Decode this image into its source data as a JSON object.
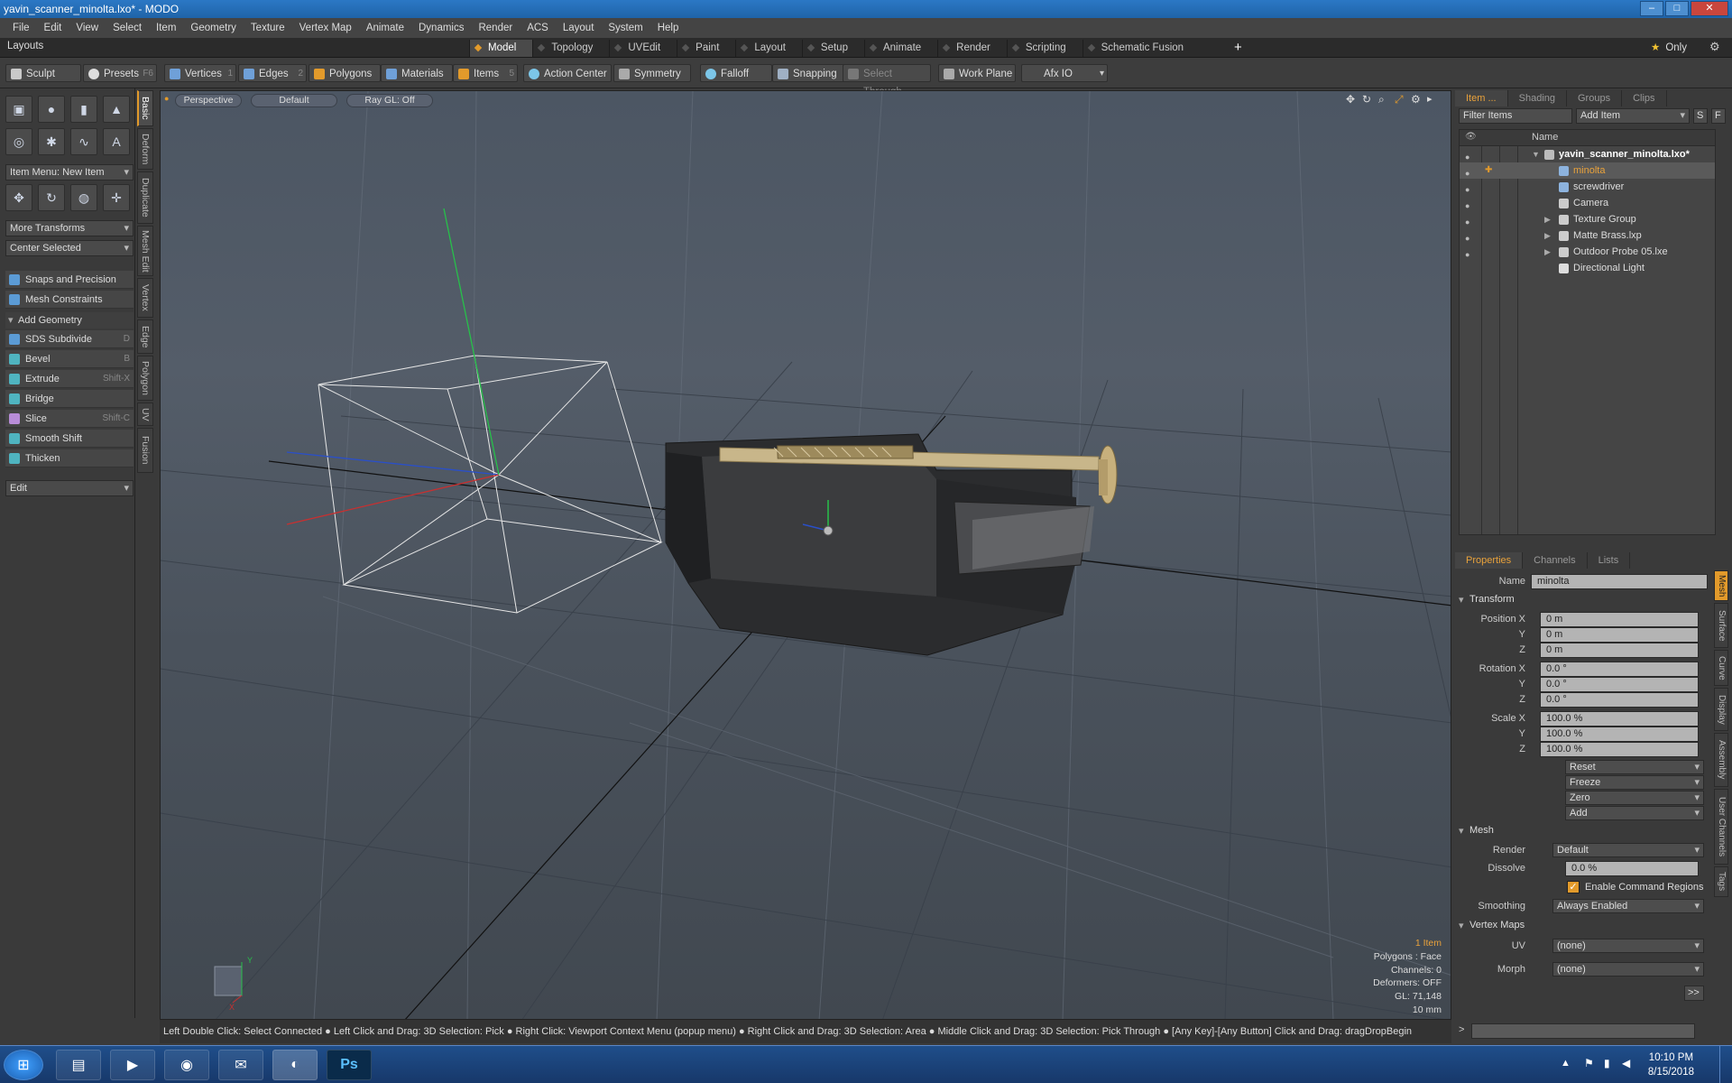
{
  "window": {
    "title": "yavin_scanner_minolta.lxo* - MODO",
    "min": "–",
    "max": "□",
    "close": "✕"
  },
  "menu": [
    "File",
    "Edit",
    "View",
    "Select",
    "Item",
    "Geometry",
    "Texture",
    "Vertex Map",
    "Animate",
    "Dynamics",
    "Render",
    "ACS",
    "Layout",
    "System",
    "Help"
  ],
  "layout_bar": {
    "label": "Layouts",
    "tabs": [
      "Model",
      "Topology",
      "UVEdit",
      "Paint",
      "Layout",
      "Setup",
      "Animate",
      "Render",
      "Scripting",
      "Schematic Fusion"
    ],
    "active": "Model",
    "plus": "+",
    "only": "Only",
    "star": "★"
  },
  "toolbar": {
    "sculpt": "Sculpt",
    "presets": "Presets",
    "presets_key": "F6",
    "vertices": "Vertices",
    "vertices_n": "1",
    "edges": "Edges",
    "edges_n": "2",
    "polygons": "Polygons",
    "materials": "Materials",
    "items": "Items",
    "items_n": "5",
    "action_center": "Action Center",
    "symmetry": "Symmetry",
    "falloff": "Falloff",
    "snapping": "Snapping",
    "select_through": "Select Through",
    "work_plane": "Work Plane",
    "afx": "Afx IO"
  },
  "left_panel": {
    "item_menu": "Item Menu: New Item",
    "more_transforms": "More Transforms",
    "center_selected": "Center Selected",
    "snaps": "Snaps and Precision",
    "mesh_constraints": "Mesh Constraints",
    "add_geometry": "Add Geometry",
    "tools": [
      {
        "label": "SDS Subdivide",
        "key": "D"
      },
      {
        "label": "Bevel",
        "key": "B"
      },
      {
        "label": "Extrude",
        "key": "Shift-X"
      },
      {
        "label": "Bridge",
        "key": ""
      },
      {
        "label": "Slice",
        "key": "Shift-C"
      },
      {
        "label": "Smooth Shift",
        "key": ""
      },
      {
        "label": "Thicken",
        "key": ""
      }
    ],
    "edit": "Edit"
  },
  "vtabs": [
    "Basic",
    "Deform",
    "Duplicate",
    "Mesh Edit",
    "Vertex",
    "Edge",
    "Polygon",
    "UV",
    "Fusion"
  ],
  "viewport": {
    "view": "Perspective",
    "shading": "Default",
    "raygl": "Ray GL: Off",
    "info": {
      "items": "1 Item",
      "polygons": "Polygons : Face",
      "channels": "Channels: 0",
      "deformers": "Deformers: OFF",
      "gl": "GL: 71,148",
      "scale": "10 mm"
    },
    "axis_y": "Y",
    "axis_x": "X"
  },
  "status": "Left Double Click: Select Connected ● Left Click and Drag: 3D Selection: Pick ● Right Click: Viewport Context Menu (popup menu) ● Right Click and Drag: 3D Selection: Area ● Middle Click and Drag: 3D Selection: Pick Through ● [Any Key]-[Any Button] Click and Drag: dragDropBegin",
  "item_panel": {
    "tabs": [
      "Item ...",
      "Shading",
      "Groups",
      "Clips"
    ],
    "filter": "Filter Items",
    "add_item": "Add Item",
    "s_btn": "S",
    "f_btn": "F",
    "col_name": "Name",
    "rows": [
      {
        "name": "yavin_scanner_minolta.lxo*"
      },
      {
        "name": "minolta"
      },
      {
        "name": "screwdriver"
      },
      {
        "name": "Camera"
      },
      {
        "name": "Texture Group"
      },
      {
        "name": "Matte Brass.lxp"
      },
      {
        "name": "Outdoor Probe 05.lxe"
      },
      {
        "name": "Directional Light"
      }
    ]
  },
  "properties": {
    "tabs": [
      "Properties",
      "Channels",
      "Lists"
    ],
    "name_label": "Name",
    "name_value": "minolta",
    "transform": "Transform",
    "pos_label": "Position X",
    "rot_label": "Rotation X",
    "scale_label": "Scale X",
    "y": "Y",
    "z": "Z",
    "pos": [
      "0 m",
      "0 m",
      "0 m"
    ],
    "rot": [
      "0.0 °",
      "0.0 °",
      "0.0 °"
    ],
    "scale": [
      "100.0 %",
      "100.0 %",
      "100.0 %"
    ],
    "reset": "Reset",
    "freeze": "Freeze",
    "zero": "Zero",
    "add": "Add",
    "mesh": "Mesh",
    "render_label": "Render",
    "render_value": "Default",
    "dissolve_label": "Dissolve",
    "dissolve_value": "0.0 %",
    "enable_cmd": "Enable Command Regions",
    "check": "✓",
    "smoothing_label": "Smoothing",
    "smoothing_value": "Always Enabled",
    "vertex_maps": "Vertex Maps",
    "uv_label": "UV",
    "uv_value": "(none)",
    "morph_label": "Morph",
    "morph_value": "(none)",
    "more": ">>",
    "side_tabs": [
      "Mesh",
      "Surface",
      "Curve",
      "Display",
      "Assembly",
      "User Channels",
      "Tags"
    ]
  },
  "taskbar": {
    "time": "10:10 PM",
    "date": "8/15/2018",
    "ps": "Ps"
  },
  "colors": {
    "accent": "#e29a2b",
    "selection": "#e9a23b",
    "titlebar": "#2b78c5"
  }
}
